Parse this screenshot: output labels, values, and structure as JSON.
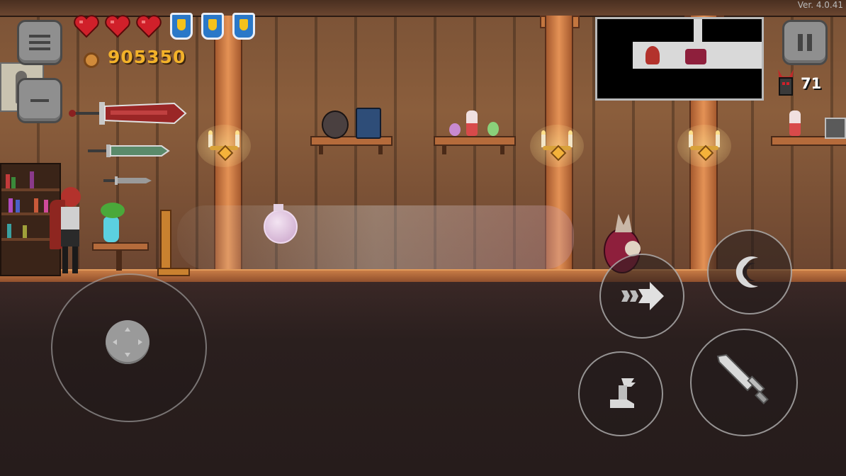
{
  "version": "Ver. 4.0.41",
  "hud": {
    "gold": "905350",
    "kills": "71",
    "hearts": 3,
    "shields": 3
  },
  "icons": {
    "menu": "menu-icon",
    "zoom_out": "zoom-out-icon",
    "pause": "pause-icon",
    "dash": "dash-icon",
    "special": "crescent-moon-icon",
    "jump": "winged-boot-icon",
    "attack": "sword-icon",
    "joystick": "dpad-icon"
  },
  "colors": {
    "gold": "#f3b229",
    "heart": "#d0202a",
    "shield": "#2a78c8",
    "wood": "#8b5e3c"
  }
}
